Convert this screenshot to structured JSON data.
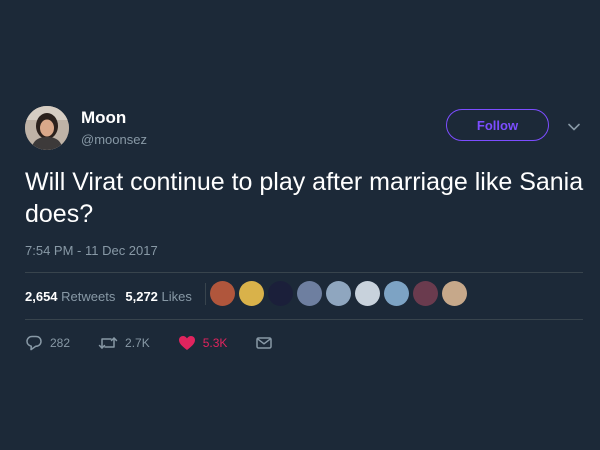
{
  "tweet": {
    "author_name": "Moon",
    "author_handle": "@moonsez",
    "follow_label": "Follow",
    "text": "Will Virat continue to play after marriage like Sania does?",
    "timestamp": "7:54 PM - 11 Dec 2017"
  },
  "stats": {
    "retweets_count": "2,654",
    "retweets_label": "Retweets",
    "likes_count": "5,272",
    "likes_label": "Likes"
  },
  "likers": [
    {
      "color": "#b0563c"
    },
    {
      "color": "#d9b24a"
    },
    {
      "color": "#1b1f3a"
    },
    {
      "color": "#6e7fa0"
    },
    {
      "color": "#8fa6bf"
    },
    {
      "color": "#c8d2dc"
    },
    {
      "color": "#7da3c4"
    },
    {
      "color": "#6a3b4e"
    },
    {
      "color": "#c6a88a"
    }
  ],
  "actions": {
    "replies": "282",
    "retweets": "2.7K",
    "likes": "5.3K"
  },
  "colors": {
    "background": "#1c2938",
    "accent": "#7c4dff",
    "like": "#e0245e",
    "muted": "#8899a6"
  },
  "icons": [
    "chevron-down-icon",
    "reply-icon",
    "retweet-icon",
    "heart-icon",
    "direct-message-icon"
  ]
}
